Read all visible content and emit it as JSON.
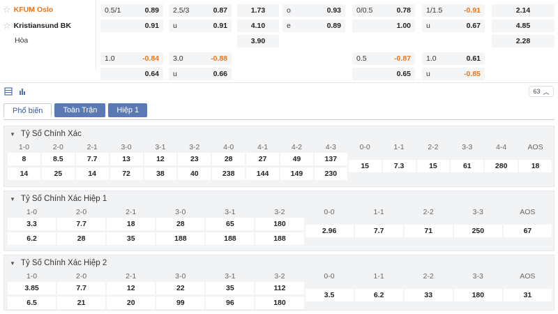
{
  "match": {
    "home": "KFUM Oslo",
    "away": "Kristiansund BK",
    "draw": "Hòa"
  },
  "odds_row1": [
    {
      "h": "0.5/1",
      "v": "0.89",
      "neg": false
    },
    {
      "h": "2.5/3",
      "v": "0.87",
      "neg": false
    },
    {
      "h": "",
      "v": "1.73",
      "neg": false
    },
    {
      "h": "o",
      "v": "0.93",
      "neg": false
    },
    {
      "h": "0/0.5",
      "v": "0.78",
      "neg": false
    },
    {
      "h": "1/1.5",
      "v": "-0.91",
      "neg": true
    },
    {
      "h": "",
      "v": "2.14",
      "neg": false
    }
  ],
  "odds_row2": [
    {
      "h": "",
      "v": "0.91",
      "neg": false
    },
    {
      "h": "u",
      "v": "0.91",
      "neg": false
    },
    {
      "h": "",
      "v": "4.10",
      "neg": false
    },
    {
      "h": "e",
      "v": "0.89",
      "neg": false
    },
    {
      "h": "",
      "v": "1.00",
      "neg": false
    },
    {
      "h": "u",
      "v": "0.67",
      "neg": false
    },
    {
      "h": "",
      "v": "4.85",
      "neg": false
    }
  ],
  "odds_row3": [
    {
      "h": "",
      "v": "3.90",
      "neg": false
    },
    {
      "h": "",
      "v": "2.28",
      "neg": false
    }
  ],
  "odds_row4": [
    {
      "h": "1.0",
      "v": "-0.84",
      "neg": true
    },
    {
      "h": "3.0",
      "v": "-0.88",
      "neg": true
    },
    {
      "h": "0.5",
      "v": "-0.87",
      "neg": true
    },
    {
      "h": "1.0",
      "v": "0.61",
      "neg": false
    }
  ],
  "odds_row5": [
    {
      "h": "",
      "v": "0.64",
      "neg": false
    },
    {
      "h": "u",
      "v": "0.66",
      "neg": false
    },
    {
      "h": "",
      "v": "0.65",
      "neg": false
    },
    {
      "h": "u",
      "v": "-0.85",
      "neg": true
    }
  ],
  "toolbar": {
    "count": "63"
  },
  "tabs": [
    "Phổ biến",
    "Toàn Trận",
    "Hiệp 1"
  ],
  "sections": [
    {
      "title": "Tỷ Số Chính Xác",
      "headers": [
        "1-0",
        "2-0",
        "2-1",
        "3-0",
        "3-1",
        "3-2",
        "4-0",
        "4-1",
        "4-2",
        "4-3",
        "0-0",
        "1-1",
        "2-2",
        "3-3",
        "4-4",
        "AOS"
      ],
      "home": [
        "8",
        "8.5",
        "7.7",
        "13",
        "12",
        "23",
        "28",
        "27",
        "49",
        "137"
      ],
      "away": [
        "14",
        "25",
        "14",
        "72",
        "38",
        "40",
        "238",
        "144",
        "149",
        "230"
      ],
      "draws": [
        "15",
        "7.3",
        "15",
        "61",
        "280",
        "18"
      ]
    },
    {
      "title": "Tỷ Số Chính Xác Hiệp 1",
      "headers": [
        "1-0",
        "2-0",
        "2-1",
        "3-0",
        "3-1",
        "3-2",
        "0-0",
        "1-1",
        "2-2",
        "3-3",
        "AOS"
      ],
      "home": [
        "3.3",
        "7.7",
        "18",
        "28",
        "65",
        "180"
      ],
      "away": [
        "6.2",
        "28",
        "35",
        "188",
        "188",
        "188"
      ],
      "draws": [
        "2.96",
        "7.7",
        "71",
        "250",
        "67"
      ]
    },
    {
      "title": "Tỷ Số Chính Xác Hiệp 2",
      "headers": [
        "1-0",
        "2-0",
        "2-1",
        "3-0",
        "3-1",
        "3-2",
        "0-0",
        "1-1",
        "2-2",
        "3-3",
        "AOS"
      ],
      "home": [
        "3.85",
        "7.7",
        "12",
        "22",
        "35",
        "112"
      ],
      "away": [
        "6.5",
        "21",
        "20",
        "99",
        "96",
        "180"
      ],
      "draws": [
        "3.5",
        "6.2",
        "33",
        "180",
        "31"
      ]
    }
  ],
  "colors": {
    "accent_orange": "#e8761c",
    "tab_blue": "#5b7ab5",
    "negative": "#e8761c"
  }
}
